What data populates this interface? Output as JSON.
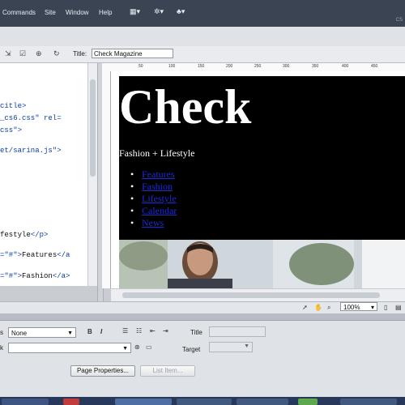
{
  "menubar": {
    "items": [
      "Commands",
      "Site",
      "Window",
      "Help"
    ],
    "corner_label": "CS"
  },
  "doc_toolbar": {
    "title_label": "Title:",
    "title_value": "Check Magazine"
  },
  "ruler": {
    "ticks": [
      "50",
      "100",
      "150",
      "200",
      "250",
      "300",
      "350",
      "400",
      "450"
    ]
  },
  "code_view": {
    "lines": [
      {
        "parts": [
          [
            "tag",
            "citle>"
          ]
        ]
      },
      {
        "parts": [
          [
            "tag",
            "_cs6.css\" rel="
          ]
        ]
      },
      {
        "parts": [
          [
            "tag",
            "css\">"
          ]
        ]
      },
      {
        "parts": [
          [
            "tag",
            "et/sarina.js\">"
          ]
        ]
      },
      {
        "parts": [
          [
            "blk",
            "festyle"
          ],
          [
            "tag",
            "</p>"
          ]
        ]
      },
      {
        "parts": [
          [
            "str",
            "=\"#\">"
          ],
          [
            "blk",
            "Features"
          ],
          [
            "tag",
            "</a"
          ]
        ]
      },
      {
        "parts": [
          [
            "str",
            "=\"#\">"
          ],
          [
            "blk",
            "Fashion"
          ],
          [
            "tag",
            "</a>"
          ]
        ]
      }
    ]
  },
  "design_view": {
    "brand": "Check",
    "tagline": "Fashion + Lifestyle",
    "nav_links": [
      "Features",
      "Fashion",
      "Lifestyle",
      "Calendar",
      "News"
    ]
  },
  "statusbar": {
    "zoom": "100%"
  },
  "property_inspector": {
    "format_label": "s",
    "format_value": "None",
    "link_label": "k",
    "link_value": "",
    "title_label": "Title",
    "target_label": "Target",
    "page_properties_button": "Page Properties...",
    "list_item_button": "List Item..."
  }
}
